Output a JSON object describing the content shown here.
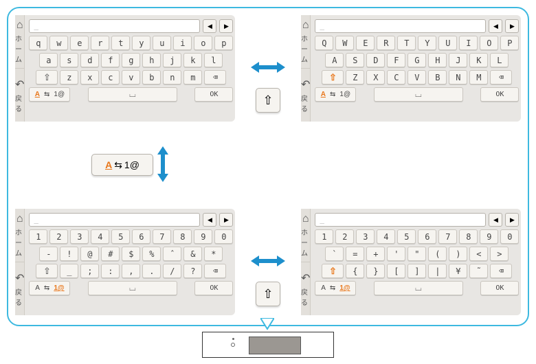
{
  "keyboards": {
    "common": {
      "input_placeholder": "_",
      "home_label": "ホーム",
      "back_label": "戻る",
      "ok_label": "OK",
      "mode_alpha": "A",
      "mode_swap": "⇆",
      "mode_sym": "1@"
    },
    "tl": {
      "r1": [
        "q",
        "w",
        "e",
        "r",
        "t",
        "y",
        "u",
        "i",
        "o",
        "p"
      ],
      "r2": [
        "a",
        "s",
        "d",
        "f",
        "g",
        "h",
        "j",
        "k",
        "l"
      ],
      "r3": [
        "z",
        "x",
        "c",
        "v",
        "b",
        "n",
        "m"
      ]
    },
    "tr": {
      "r1": [
        "Q",
        "W",
        "E",
        "R",
        "T",
        "Y",
        "U",
        "I",
        "O",
        "P"
      ],
      "r2": [
        "A",
        "S",
        "D",
        "F",
        "G",
        "H",
        "J",
        "K",
        "L"
      ],
      "r3": [
        "Z",
        "X",
        "C",
        "V",
        "B",
        "N",
        "M"
      ]
    },
    "bl": {
      "r1": [
        "1",
        "2",
        "3",
        "4",
        "5",
        "6",
        "7",
        "8",
        "9",
        "0"
      ],
      "r2": [
        "-",
        "!",
        "@",
        "#",
        "$",
        "%",
        "ˆ",
        "&",
        "*"
      ],
      "r3": [
        "_",
        ";",
        ":",
        ",",
        ".",
        "/",
        "?"
      ]
    },
    "br": {
      "r1": [
        "1",
        "2",
        "3",
        "4",
        "5",
        "6",
        "7",
        "8",
        "9",
        "0"
      ],
      "r2": [
        "`",
        "=",
        "+",
        "'",
        "\"",
        "(",
        ")",
        "<",
        ">"
      ],
      "r3": [
        "{",
        "}",
        "[",
        "]",
        "|",
        "¥",
        "˜"
      ]
    }
  },
  "nav": {
    "left": "◀",
    "right": "▶"
  },
  "icons": {
    "shift": "⇧",
    "backspace": "⌫",
    "space": "⌴",
    "home": "⌂",
    "back": "↶"
  }
}
